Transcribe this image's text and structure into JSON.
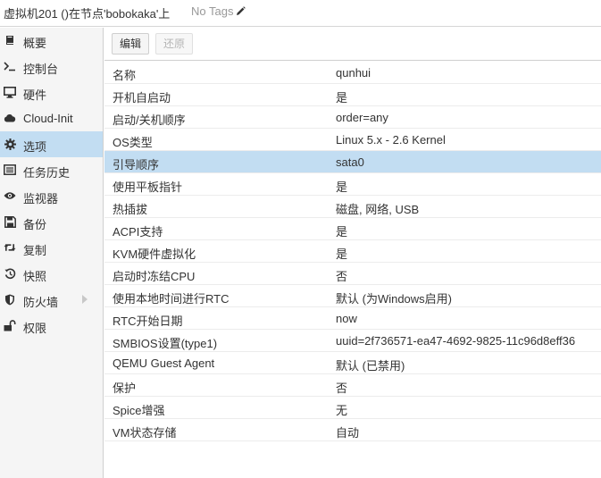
{
  "header": {
    "vm_title": "虚拟机201 ()在节点'bobokaka'上",
    "tags_label": "No Tags"
  },
  "sidebar": {
    "items": [
      {
        "label": "概要",
        "icon": "book-icon"
      },
      {
        "label": "控制台",
        "icon": "terminal-icon"
      },
      {
        "label": "硬件",
        "icon": "desktop-icon"
      },
      {
        "label": "Cloud-Init",
        "icon": "cloud-icon"
      },
      {
        "label": "选项",
        "icon": "gear-icon",
        "active": true
      },
      {
        "label": "任务历史",
        "icon": "list-icon"
      },
      {
        "label": "监视器",
        "icon": "eye-icon"
      },
      {
        "label": "备份",
        "icon": "floppy-icon"
      },
      {
        "label": "复制",
        "icon": "retweet-icon"
      },
      {
        "label": "快照",
        "icon": "history-icon"
      },
      {
        "label": "防火墙",
        "icon": "shield-icon",
        "expandable": true
      },
      {
        "label": "权限",
        "icon": "unlock-icon"
      }
    ]
  },
  "toolbar": {
    "edit_label": "编辑",
    "revert_label": "还原"
  },
  "options": {
    "rows": [
      {
        "key": "名称",
        "value": "qunhui"
      },
      {
        "key": "开机自启动",
        "value": "是"
      },
      {
        "key": "启动/关机顺序",
        "value": "order=any"
      },
      {
        "key": "OS类型",
        "value": "Linux 5.x - 2.6 Kernel"
      },
      {
        "key": "引导顺序",
        "value": "sata0",
        "selected": true
      },
      {
        "key": "使用平板指针",
        "value": "是"
      },
      {
        "key": "热插拔",
        "value": "磁盘, 网络, USB"
      },
      {
        "key": "ACPI支持",
        "value": "是"
      },
      {
        "key": "KVM硬件虚拟化",
        "value": "是"
      },
      {
        "key": "启动时冻结CPU",
        "value": "否"
      },
      {
        "key": "使用本地时间进行RTC",
        "value": "默认 (为Windows启用)"
      },
      {
        "key": "RTC开始日期",
        "value": "now"
      },
      {
        "key": "SMBIOS设置(type1)",
        "value": "uuid=2f736571-ea47-4692-9825-11c96d8eff36"
      },
      {
        "key": "QEMU Guest Agent",
        "value": "默认 (已禁用)"
      },
      {
        "key": "保护",
        "value": "否"
      },
      {
        "key": "Spice增强",
        "value": "无"
      },
      {
        "key": "VM状态存储",
        "value": "自动"
      }
    ]
  },
  "colors": {
    "selection": "#c2ddf2",
    "sidebar_bg": "#f5f5f5"
  }
}
